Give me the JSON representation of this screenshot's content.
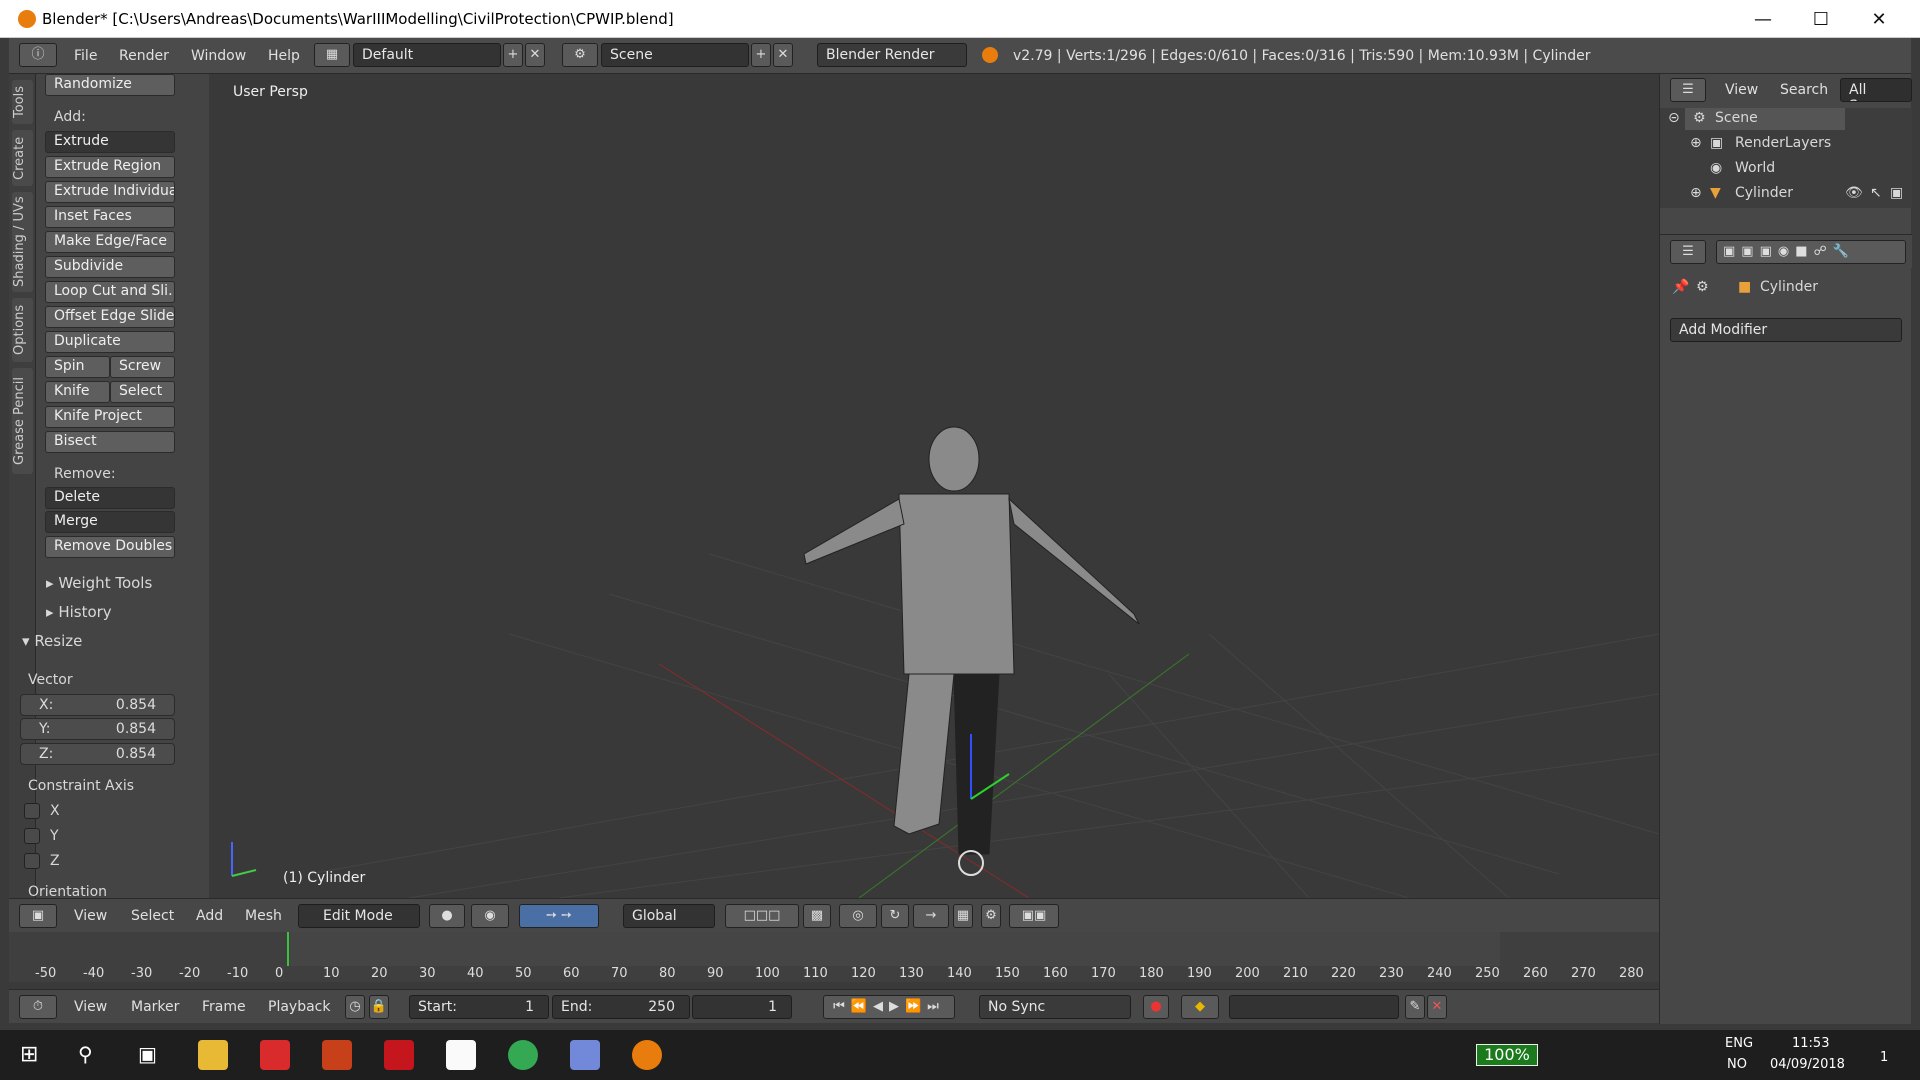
{
  "window": {
    "title": "Blender* [C:\\Users\\Andreas\\Documents\\WarIIIModelling\\CivilProtection\\CPWIP.blend]"
  },
  "menubar": {
    "menus": [
      "File",
      "Render",
      "Window",
      "Help"
    ],
    "layout": "Default",
    "scene": "Scene",
    "engine": "Blender Render",
    "stats": "v2.79 | Verts:1/296 | Edges:0/610 | Faces:0/316 | Tris:590 | Mem:10.93M | Cylinder"
  },
  "tabs": [
    "Tools",
    "Create",
    "Shading / UVs",
    "Options",
    "Grease Pencil"
  ],
  "tools": {
    "randomize": "Randomize",
    "add_label": "Add:",
    "extrude": "Extrude",
    "extrude_region": "Extrude Region",
    "extrude_individual": "Extrude Individual",
    "inset_faces": "Inset Faces",
    "make_edge_face": "Make Edge/Face",
    "subdivide": "Subdivide",
    "loop_cut": "Loop Cut and Sli...",
    "offset_edge_slide": "Offset Edge Slide",
    "duplicate": "Duplicate",
    "spin": "Spin",
    "screw": "Screw",
    "knife": "Knife",
    "select": "Select",
    "knife_project": "Knife Project",
    "bisect": "Bisect",
    "remove_label": "Remove:",
    "delete": "Delete",
    "merge": "Merge",
    "remove_doubles": "Remove Doubles",
    "weight_tools": "Weight Tools",
    "history": "History",
    "resize": "Resize",
    "vector": "Vector",
    "x_label": "X:",
    "x_val": "0.854",
    "y_label": "Y:",
    "y_val": "0.854",
    "z_label": "Z:",
    "z_val": "0.854",
    "constraint_axis": "Constraint Axis",
    "cx": "X",
    "cy": "Y",
    "cz": "Z",
    "orientation": "Orientation"
  },
  "viewport": {
    "persp": "User Persp",
    "object": "(1) Cylinder"
  },
  "view_header": {
    "menus": [
      "View",
      "Select",
      "Add",
      "Mesh"
    ],
    "mode": "Edit Mode",
    "orientation": "Global"
  },
  "timeline": {
    "ticks": [
      "-50",
      "-40",
      "-30",
      "-20",
      "-10",
      "0",
      "10",
      "20",
      "30",
      "40",
      "50",
      "60",
      "70",
      "80",
      "90",
      "100",
      "110",
      "120",
      "130",
      "140",
      "150",
      "160",
      "170",
      "180",
      "190",
      "200",
      "210",
      "220",
      "230",
      "240",
      "250",
      "260",
      "270",
      "280"
    ],
    "menus": [
      "View",
      "Marker",
      "Frame",
      "Playback"
    ],
    "start_label": "Start:",
    "start": "1",
    "end_label": "End:",
    "end": "250",
    "current": "1",
    "sync": "No Sync"
  },
  "outliner": {
    "menus": [
      "View",
      "Search",
      "All Scenes"
    ],
    "items": [
      "Scene",
      "RenderLayers",
      "World",
      "Cylinder"
    ]
  },
  "properties": {
    "object": "Cylinder",
    "add_modifier": "Add Modifier"
  },
  "taskbar": {
    "battery": "100%",
    "lang1": "ENG",
    "lang2": "NO",
    "time": "11:53",
    "date": "04/09/2018",
    "notif": "1"
  }
}
